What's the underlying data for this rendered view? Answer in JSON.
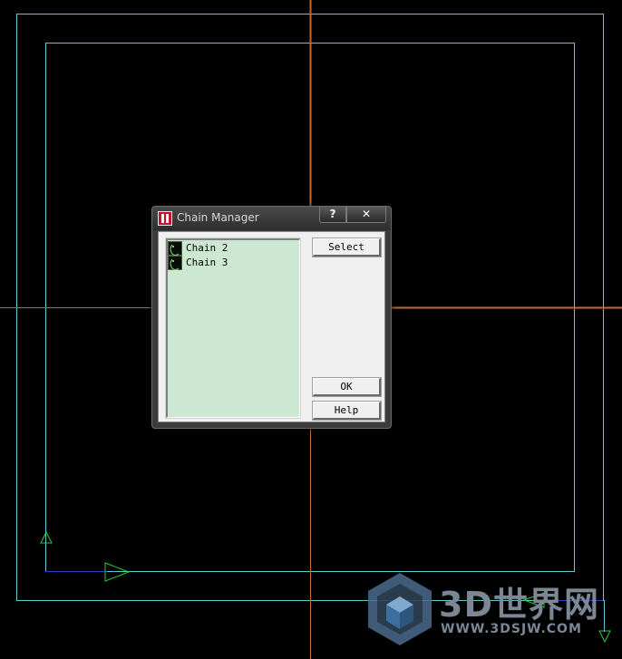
{
  "dialog": {
    "title": "Chain Manager",
    "help_caption": "?",
    "close_caption": "✕",
    "list": {
      "items": [
        {
          "label": "Chain 2"
        },
        {
          "label": "Chain 3"
        }
      ]
    },
    "buttons": {
      "select": "Select",
      "ok": "OK",
      "help": "Help"
    }
  },
  "watermark": {
    "title": "3D世界网",
    "url": "WWW.3DSJW.COM"
  },
  "colors": {
    "background": "#000000",
    "boundary": "#5fc9d2",
    "axis": "#c06a32",
    "chain_arrow": "#2ecc40",
    "list_bg": "#cde8d2",
    "dialog_face": "#f0f0f0"
  },
  "icons": {
    "app": "mastercam-app-icon",
    "chain": "chain-contour-icon"
  }
}
